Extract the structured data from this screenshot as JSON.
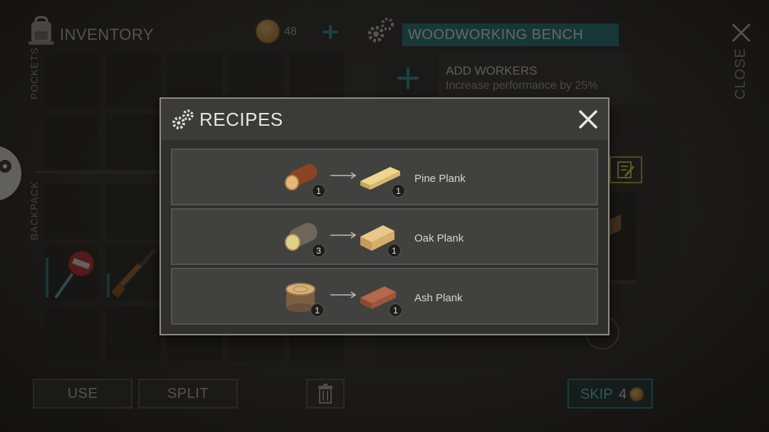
{
  "inventory": {
    "title": "INVENTORY",
    "pockets_label": "POCKETS",
    "backpack_label": "BACKPACK",
    "coins": "48",
    "use_label": "USE",
    "split_label": "SPLIT"
  },
  "bench": {
    "title": "WOODWORKING BENCH",
    "add_workers_title": "ADD WORKERS",
    "add_workers_desc": "Increase performance by 25%",
    "close_label": "CLOSE",
    "skip_label": "SKIP",
    "skip_cost": "4"
  },
  "recipes": {
    "title": "RECIPES",
    "items": [
      {
        "input_qty": "1",
        "output_qty": "1",
        "output_name": "Pine Plank"
      },
      {
        "input_qty": "3",
        "output_qty": "1",
        "output_name": "Oak Plank"
      },
      {
        "input_qty": "1",
        "output_qty": "1",
        "output_name": "Ash Plank"
      }
    ]
  },
  "colors": {
    "accent": "#1f6f73",
    "modal_bg": "#2f302d",
    "row_bg": "#41423f"
  }
}
